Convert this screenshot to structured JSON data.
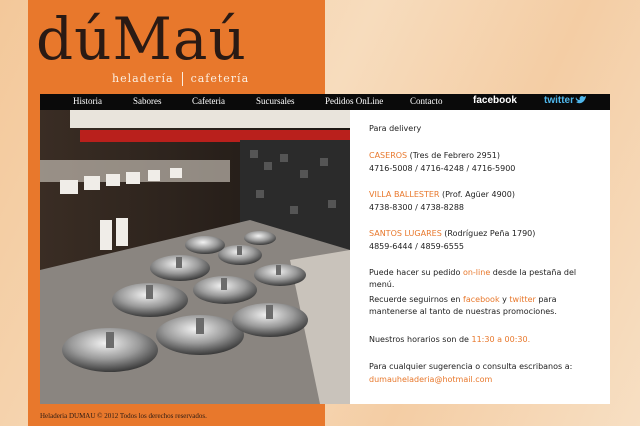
{
  "brand": {
    "logo": "dúMaú",
    "tagline_left": "heladería",
    "tagline_right": "cafetería"
  },
  "nav": {
    "items": [
      "Historia",
      "Sabores",
      "Cafeteria",
      "Sucursales",
      "Pedidos OnLine",
      "Contacto"
    ],
    "facebook": "facebook",
    "twitter": "twitter"
  },
  "content": {
    "delivery_title": "Para delivery",
    "branches": [
      {
        "name": "CASEROS",
        "address": " (Tres de Febrero 2951)",
        "phones": "4716-5008 / 4716-4248 / 4716-5900"
      },
      {
        "name": "VILLA BALLESTER",
        "address": " (Prof. Agüer 4900)",
        "phones": "4738-8300 / 4738-8288"
      },
      {
        "name": "SANTOS LUGARES",
        "address": " (Rodríguez Peña 1790)",
        "phones": "4859-6444 / 4859-6555"
      }
    ],
    "online_pre": "Puede hacer su pedido ",
    "online_link": "on-line",
    "online_post": " desde la pestaña del menú.",
    "follow_pre": "Recuerde seguirnos en ",
    "follow_fb": "facebook",
    "follow_mid": " y ",
    "follow_tw": "twitter",
    "follow_post": " para mantenerse al tanto de nuestras promociones.",
    "hours_pre": "Nuestros horarios son de ",
    "hours_value": "11:30 a 00:30.",
    "contact_text": "Para cualquier sugerencia o consulta escribanos a:",
    "email": "dumauheladeria@hotmail.com"
  },
  "footer": {
    "text": "Heladeria DUMAU © 2012 Todos los derechos reservados."
  },
  "colors": {
    "accent": "#e8782c",
    "nav_bg": "#0a0a0a",
    "twitter": "#4fb6ea"
  }
}
